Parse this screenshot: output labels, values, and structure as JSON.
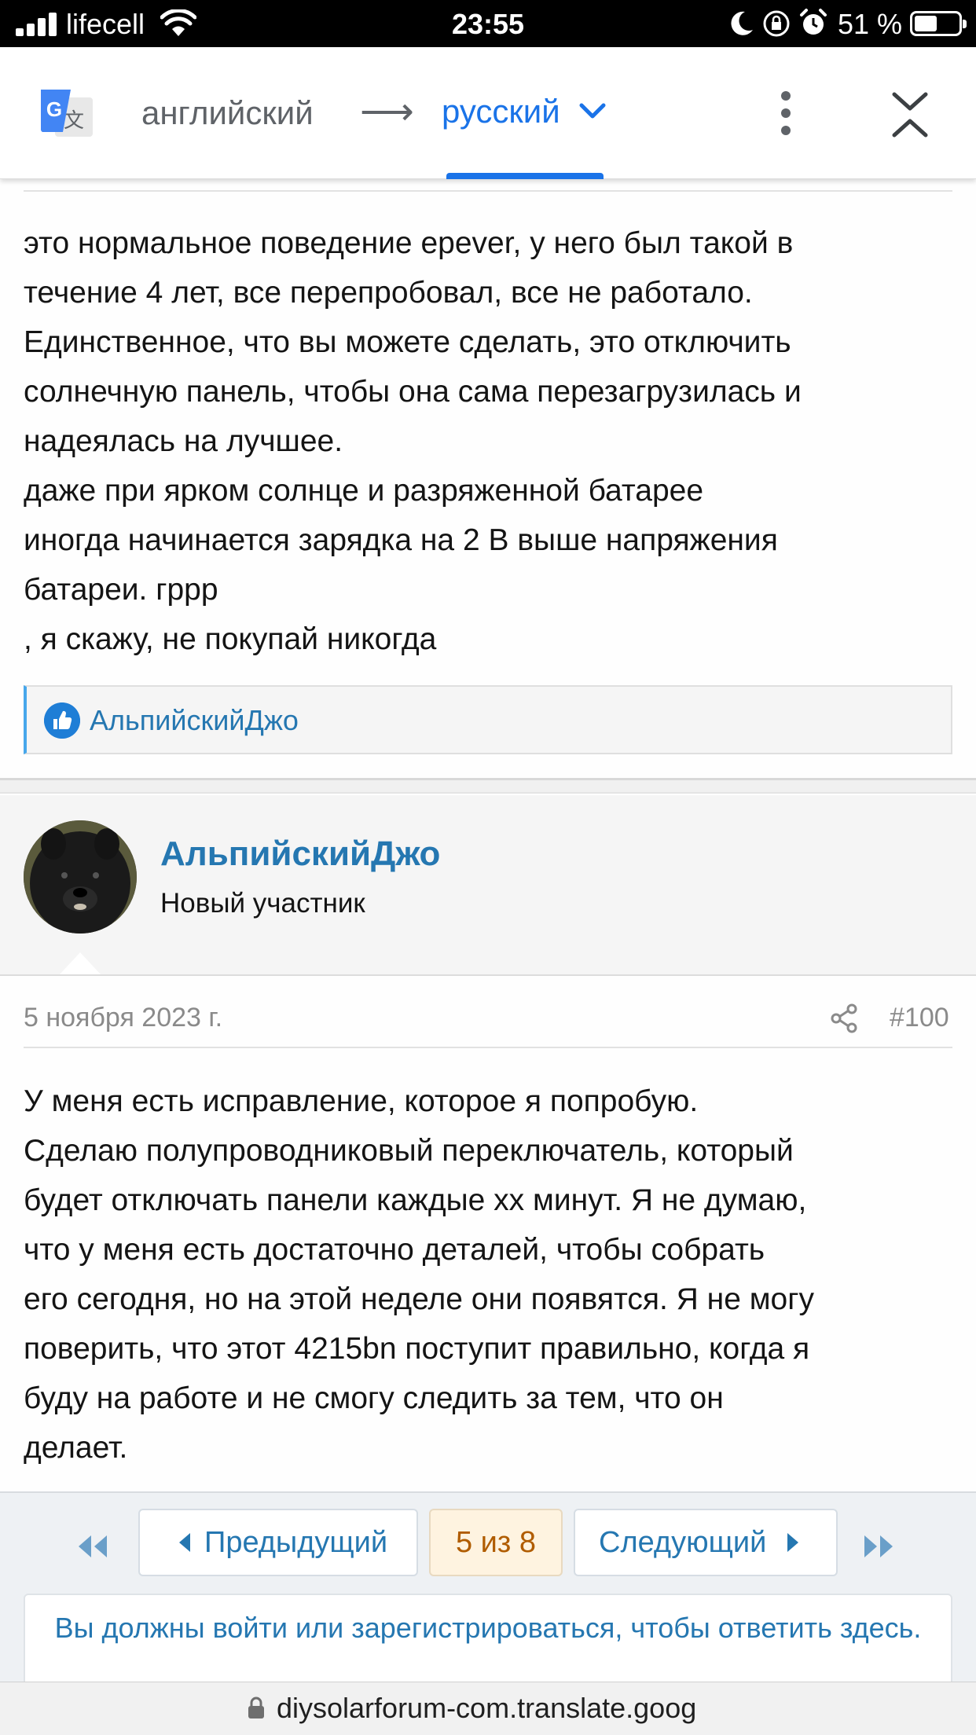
{
  "status_bar": {
    "carrier": "lifecell",
    "time": "23:55",
    "battery": "51 %",
    "battery_level": 0.51
  },
  "translate_bar": {
    "source_lang": "английский",
    "target_lang": "русский",
    "accent_color": "#1a73e8"
  },
  "post1": {
    "lines": [
      "это нормальное поведение epever, у него был такой в",
      "течение 4 лет, все перепробовал, все не работало.",
      "Единственное, что вы можете сделать, это отключить",
      "солнечную панель, чтобы она сама перезагрузилась и",
      "надеялась на лучшее.",
      "даже при ярком солнце и разряженной батарее",
      "иногда начинается зарядка на 2 В выше напряжения",
      "батареи. гррр",
      ", я скажу, не покупай никогда"
    ],
    "reaction_user": "АльпийскийДжо"
  },
  "post2": {
    "username": "АльпийскийДжо",
    "user_title": "Новый участник",
    "date": "5 ноября 2023 г.",
    "post_number": "#100",
    "lines": [
      "У меня есть исправление, которое я попробую.",
      "Сделаю полупроводниковый переключатель, который",
      "будет отключать панели каждые xx минут. Я не думаю,",
      "что у меня есть достаточно деталей, чтобы собрать",
      "его сегодня, но на этой неделе они появятся. Я не могу",
      "поверить, что этот 4215bn поступит правильно, когда я",
      "буду на работе и не смогу следить за тем, что он",
      "делает."
    ]
  },
  "pager": {
    "prev_label": "Предыдущий",
    "current": "5 из 8",
    "next_label": "Следующий",
    "login_prompt": "Вы должны войти или зарегистрироваться, чтобы ответить здесь."
  },
  "url_bar": {
    "url": "diysolarforum-com.translate.goog"
  }
}
